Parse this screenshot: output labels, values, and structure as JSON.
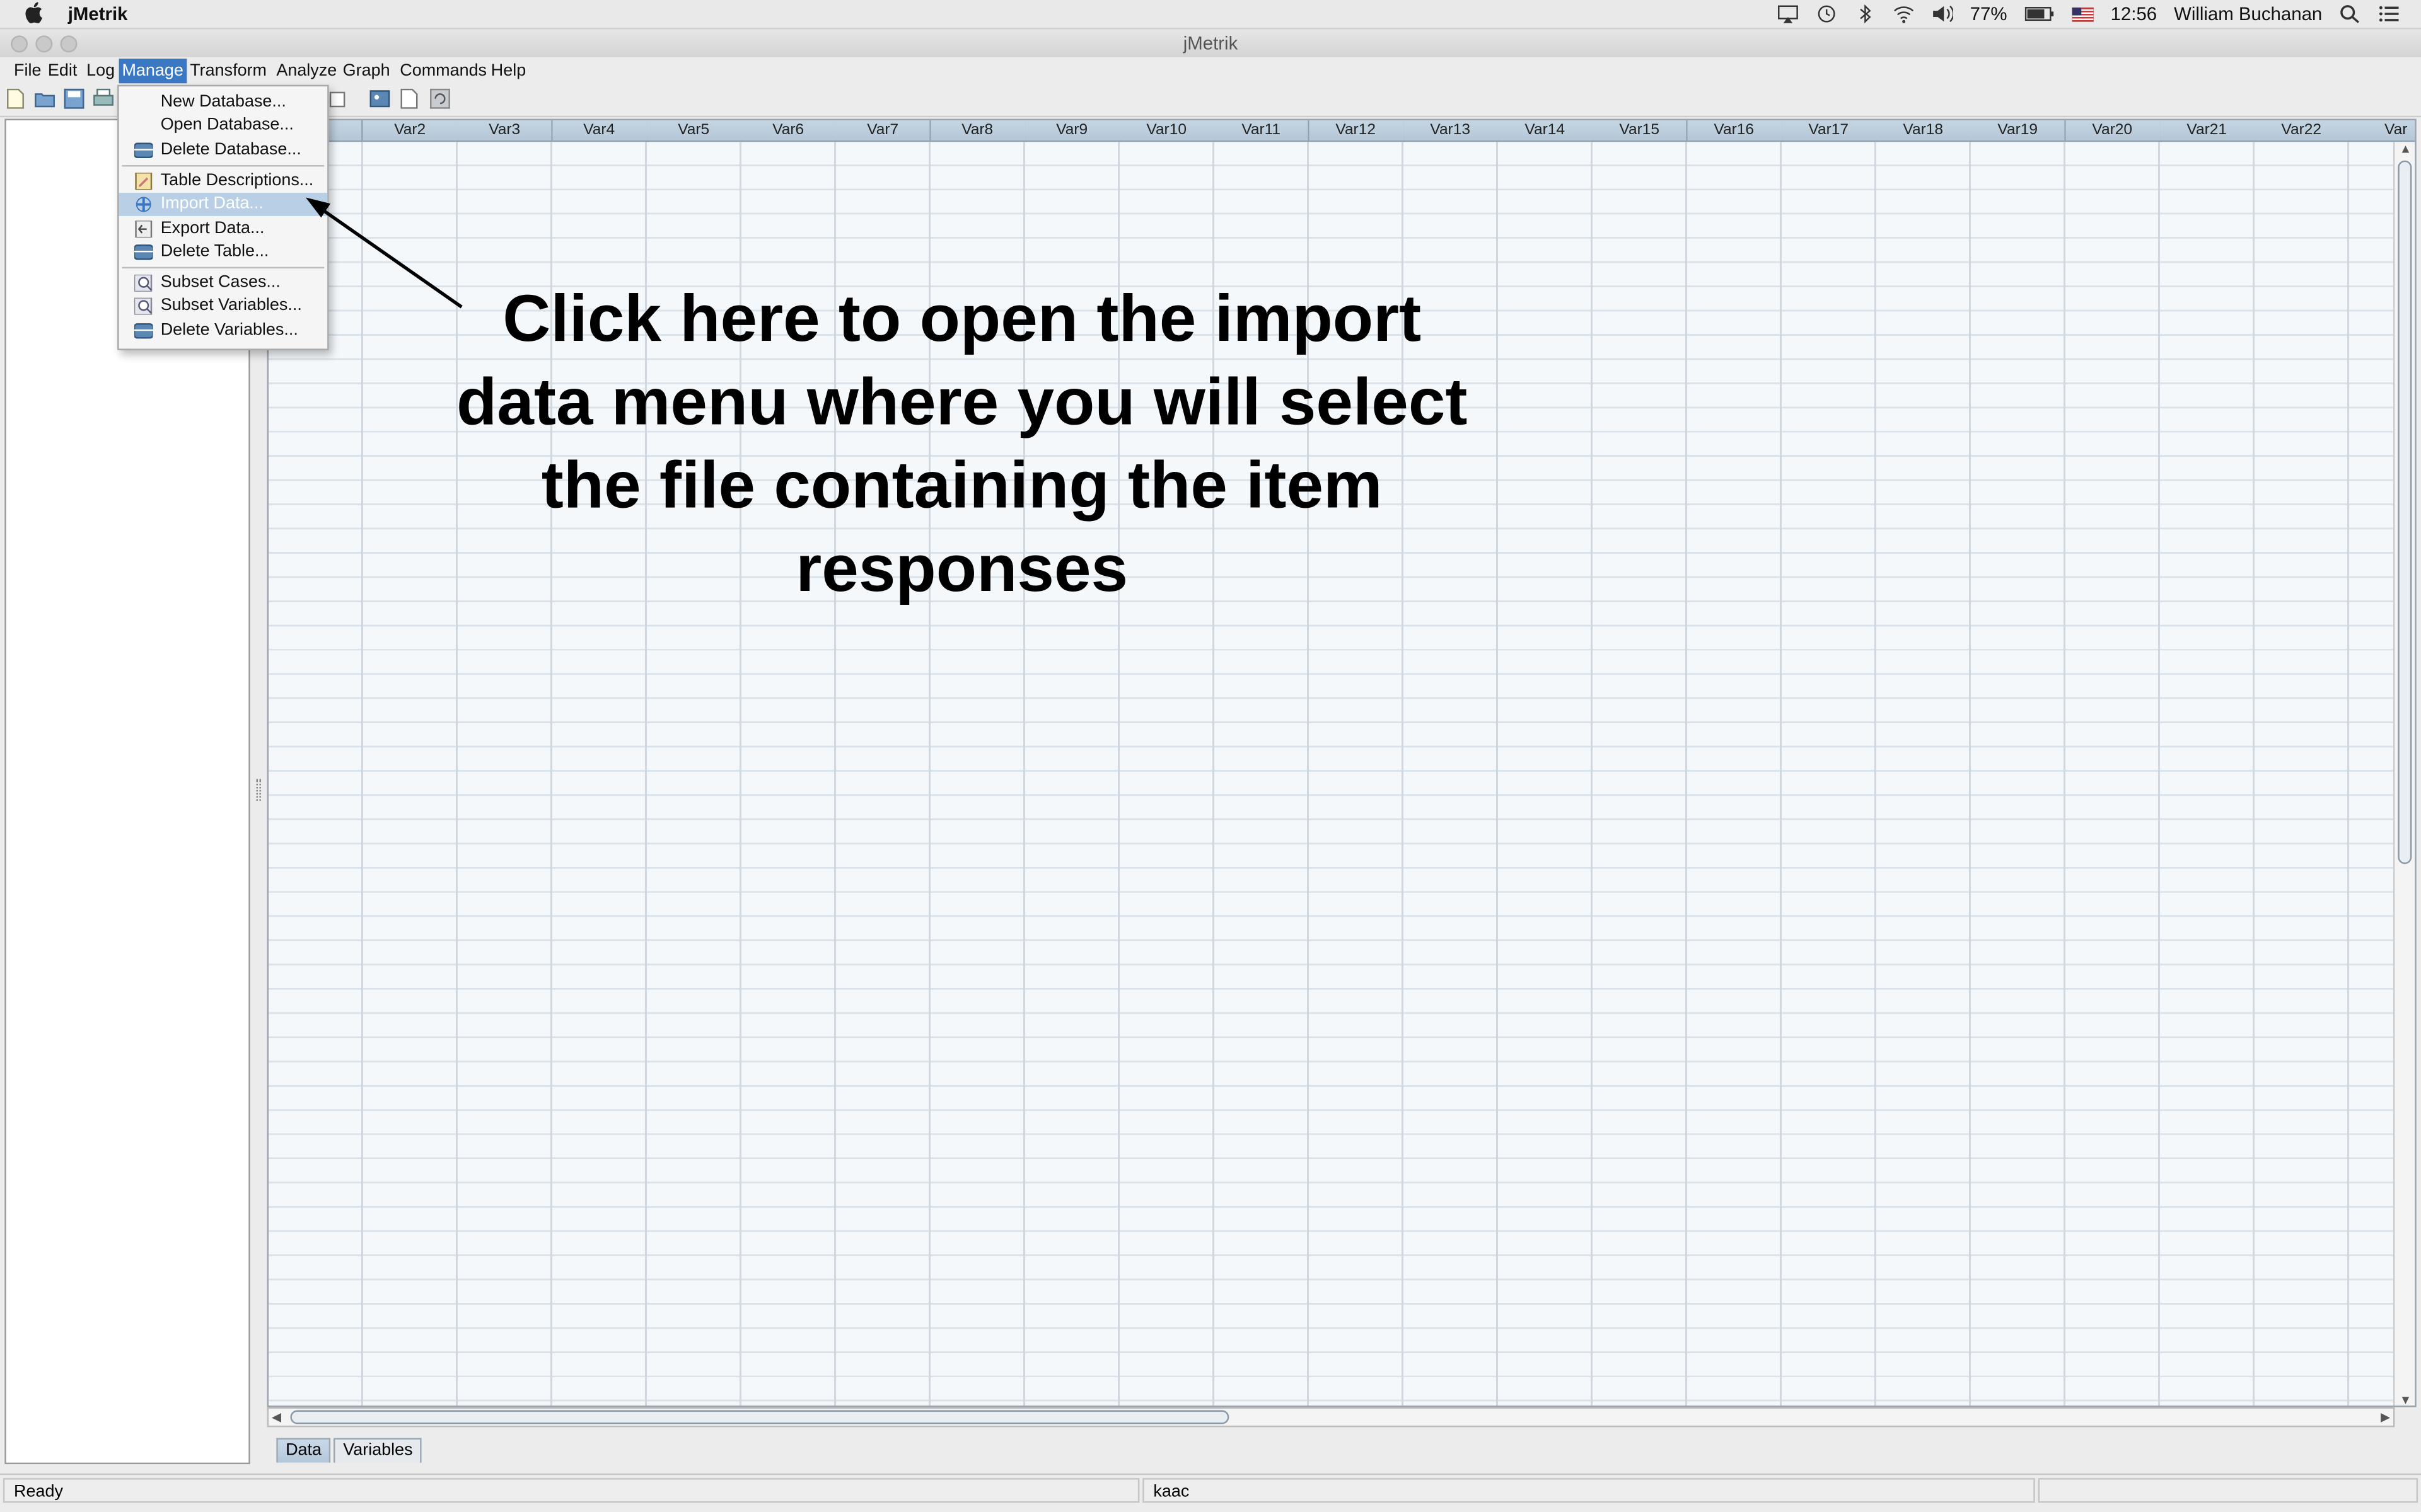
{
  "mac_menubar": {
    "app_name": "jMetrik",
    "battery": "77%",
    "clock": "12:56",
    "user": "William Buchanan"
  },
  "window": {
    "title": "jMetrik"
  },
  "menu_bar": {
    "items": [
      "File",
      "Edit",
      "Log",
      "Manage",
      "Transform",
      "Analyze",
      "Graph",
      "Commands",
      "Help"
    ],
    "active": "Manage"
  },
  "manage_menu": {
    "items": [
      {
        "label": "New Database...",
        "icon": "none"
      },
      {
        "label": "Open Database...",
        "icon": "none"
      },
      {
        "label": "Delete Database...",
        "icon": "database-icon"
      },
      {
        "label": "Table Descriptions...",
        "icon": "notepad-icon"
      },
      {
        "label": "Import Data...",
        "icon": "plus-icon",
        "highlighted": true
      },
      {
        "label": "Export Data...",
        "icon": "export-icon"
      },
      {
        "label": "Delete Table...",
        "icon": "database-icon"
      },
      {
        "label": "Subset Cases...",
        "icon": "magnifier-icon"
      },
      {
        "label": "Subset Variables...",
        "icon": "magnifier-icon"
      },
      {
        "label": "Delete Variables...",
        "icon": "database-icon"
      }
    ]
  },
  "grid": {
    "columns": [
      "Var2",
      "Var3",
      "Var4",
      "Var5",
      "Var6",
      "Var7",
      "Var8",
      "Var9",
      "Var10",
      "Var11",
      "Var12",
      "Var13",
      "Var14",
      "Var15",
      "Var16",
      "Var17",
      "Var18",
      "Var19",
      "Var20",
      "Var21",
      "Var22",
      "Var"
    ]
  },
  "tabs": [
    "Data",
    "Variables"
  ],
  "active_tab": "Data",
  "status": {
    "left": "Ready",
    "middle": "kaac",
    "right": ""
  },
  "annotation": {
    "lines": [
      "Click here to open the import",
      "data menu where you will select",
      "the file containing the item",
      "responses"
    ]
  },
  "colors": {
    "menu_active": "#3a78c4",
    "menu_highlight": "#b8cfe6",
    "column_header": "#c0d1e0",
    "grid_row": "#f4f8fb"
  }
}
